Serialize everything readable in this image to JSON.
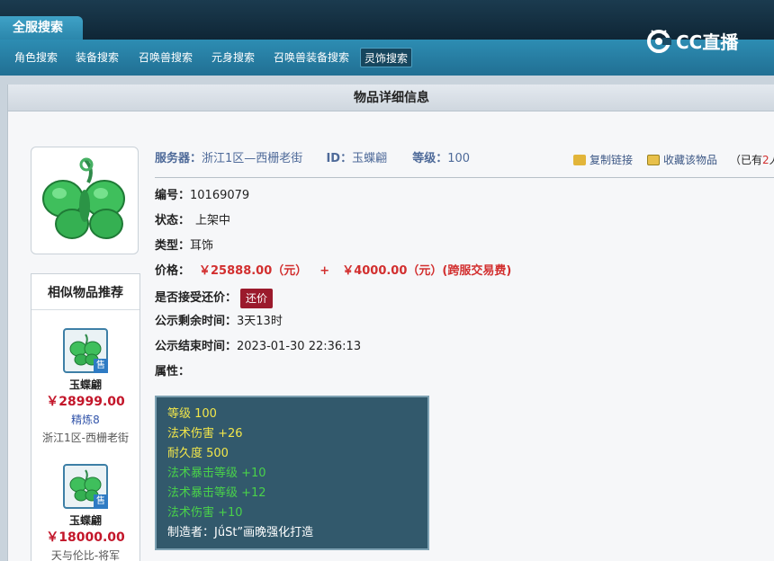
{
  "header": {
    "main_tab": "全服搜索",
    "logo_text": "CC直播",
    "nav": [
      {
        "label": "角色搜索"
      },
      {
        "label": "装备搜索"
      },
      {
        "label": "召唤兽搜索"
      },
      {
        "label": "元身搜索"
      },
      {
        "label": "召唤兽装备搜索"
      },
      {
        "label": "灵饰搜索",
        "active": true
      }
    ]
  },
  "panel": {
    "title": "物品详细信息"
  },
  "item": {
    "server_label": "服务器：",
    "server_value": "浙江1区—西栅老街",
    "id_label": "ID：",
    "id_value": "玉蝶翩",
    "level_label": "等级：",
    "level_value": "100",
    "copy_link": "复制链接",
    "favorite": "收藏该物品",
    "favorite_count_prefix": "（已有",
    "favorite_count": "2",
    "favorite_count_suffix": "人",
    "serial_label": "编号：",
    "serial_value": "10169079",
    "status_label": "状态：",
    "status_value": "上架中",
    "type_label": "类型：",
    "type_value": "耳饰",
    "price_label": "价格：",
    "price_value": "￥25888.00（元）",
    "price_plus": "+",
    "fee_value": "￥4000.00（元）(跨服交易费)",
    "counter_label": "是否接受还价：",
    "counter_button": "还价",
    "remain_label": "公示剩余时间：",
    "remain_value": "3天13时",
    "end_label": "公示结束时间：",
    "end_value": "2023-01-30 22:36:13",
    "attr_label": "属性："
  },
  "attributes": [
    {
      "text": "等级 100",
      "color": "#f2e64a"
    },
    {
      "text": "法术伤害 +26",
      "color": "#f2e64a"
    },
    {
      "text": "耐久度 500",
      "color": "#f2e64a"
    },
    {
      "text": "法术暴击等级 +10",
      "color": "#49d14a"
    },
    {
      "text": "法术暴击等级 +12",
      "color": "#49d14a"
    },
    {
      "text": "法术伤害 +10",
      "color": "#49d14a"
    },
    {
      "text": "制造者：JǘSt”画晚强化打造",
      "color": "#ffffff"
    }
  ],
  "similar": {
    "title": "相似物品推荐",
    "sale_badge": "售",
    "items": [
      {
        "name": "玉蝶翩",
        "price": "￥28999.00",
        "refine": "精炼8",
        "server": "浙江1区-西栅老街"
      },
      {
        "name": "玉蝶翩",
        "price": "￥18000.00",
        "server": "天与伦比-将军"
      }
    ]
  },
  "colors": {
    "accent": "#2a85aa",
    "price_red": "#d22f2f",
    "counter_btn": "#9b1a2c"
  }
}
